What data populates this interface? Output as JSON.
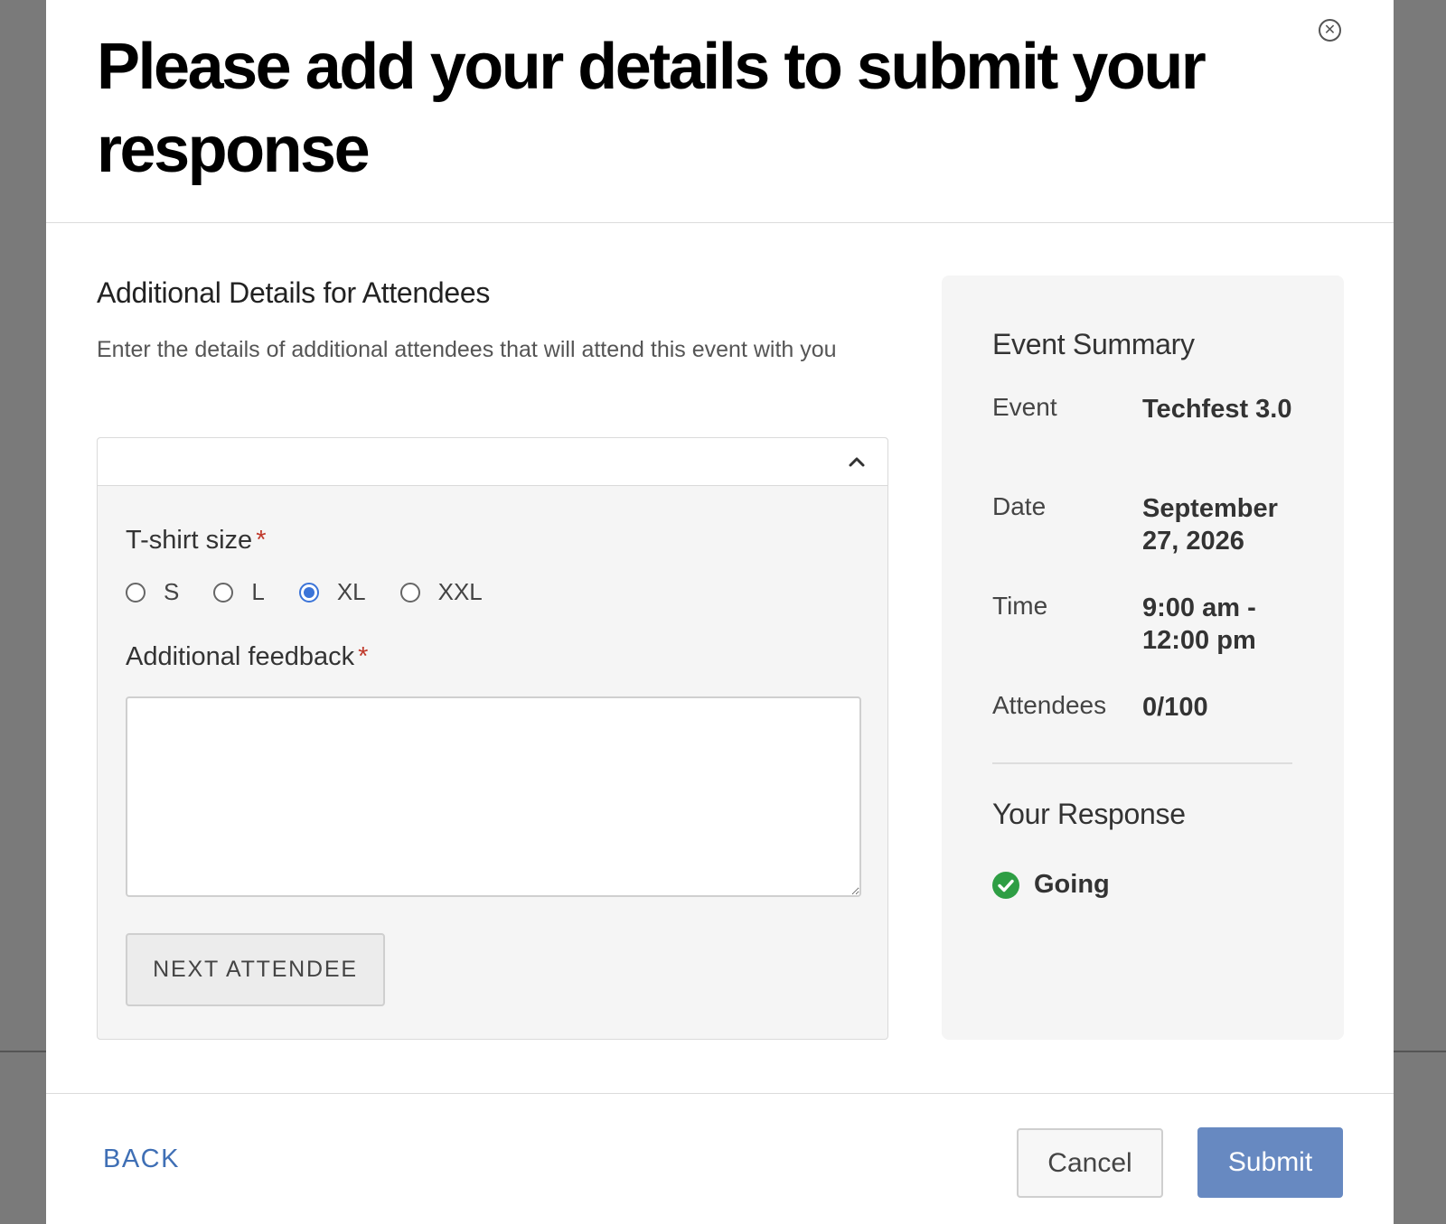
{
  "modal": {
    "title": "Please add your details to submit your response",
    "close_icon": "close-circle-icon"
  },
  "attendees": {
    "heading": "Additional Details for Attendees",
    "description": "Enter the details of additional attendees that will attend this event with you",
    "collapse_icon": "chevron-up-icon",
    "tshirt": {
      "label": "T-shirt size",
      "required": "*",
      "options": [
        "S",
        "L",
        "XL",
        "XXL"
      ],
      "selected": "XL"
    },
    "feedback": {
      "label": "Additional feedback",
      "required": "*",
      "value": ""
    },
    "next_button": "NEXT ATTENDEE"
  },
  "summary": {
    "heading": "Event Summary",
    "rows": [
      {
        "key": "Event",
        "value": "Techfest 3.0"
      },
      {
        "key": "Date",
        "value": "September 27, 2026"
      },
      {
        "key": "Time",
        "value": "9:00 am - 12:00 pm"
      },
      {
        "key": "Attendees",
        "value": "0/100"
      }
    ],
    "response_heading": "Your Response",
    "response_value": "Going",
    "response_icon": "check-circle-icon",
    "response_color": "#2e9e44"
  },
  "footer": {
    "back": "BACK",
    "cancel": "Cancel",
    "submit": "Submit"
  },
  "colors": {
    "accent": "#3b74d8",
    "submit_bg": "#6789c1",
    "link": "#3f6fb5",
    "required": "#c0392b"
  }
}
